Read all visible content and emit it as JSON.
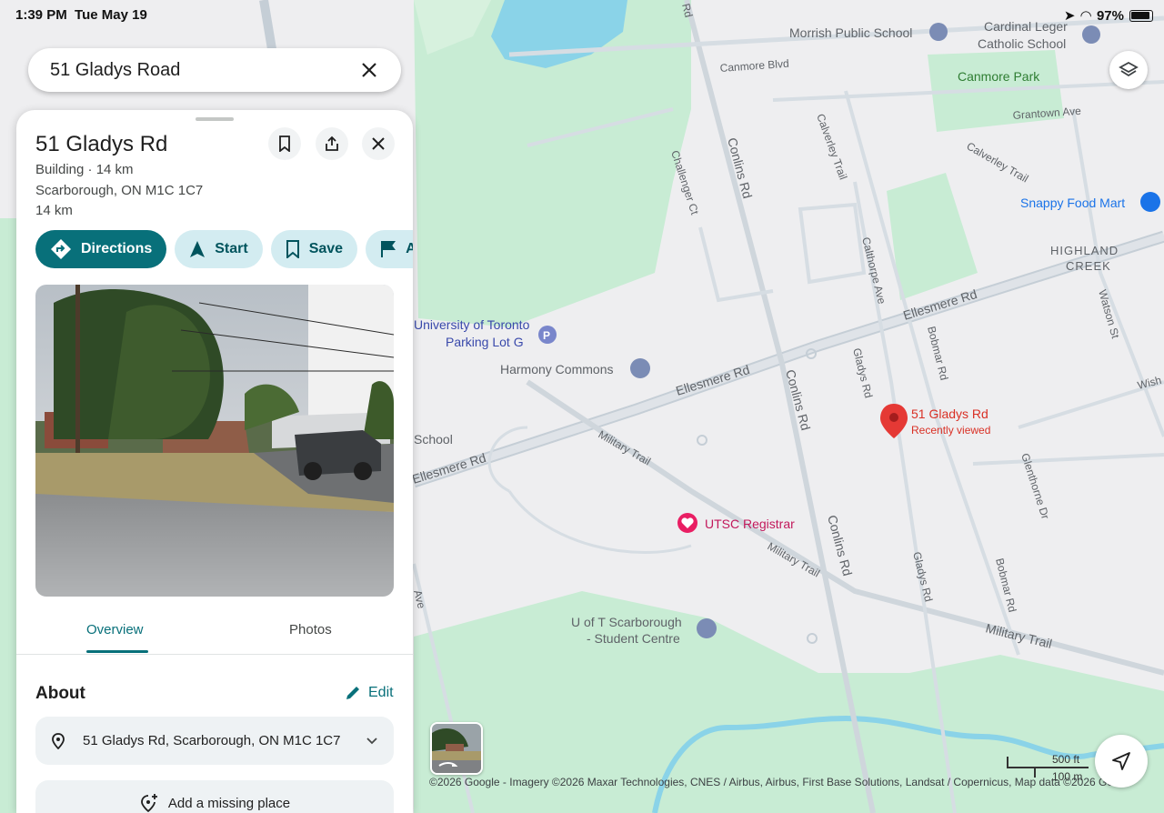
{
  "status_bar": {
    "time": "1:39 PM",
    "date": "Tue May 19",
    "battery": "97%"
  },
  "search": {
    "query": "51 Gladys Road"
  },
  "place": {
    "name": "51 Gladys Rd",
    "category_line": "Building · 14 km",
    "locality": "Scarborough, ON M1C 1C7",
    "distance": "14 km",
    "actions": [
      {
        "label": "Directions",
        "icon": "directions-icon"
      },
      {
        "label": "Start",
        "icon": "navigation-arrow-icon"
      },
      {
        "label": "Save",
        "icon": "bookmark-icon"
      },
      {
        "label": "A",
        "icon": "flag-icon"
      }
    ]
  },
  "tabs": {
    "overview": "Overview",
    "photos": "Photos"
  },
  "about": {
    "heading": "About",
    "edit_label": "Edit",
    "full_address": "51 Gladys Rd, Scarborough, ON M1C 1C7",
    "add_missing": "Add a missing place"
  },
  "map": {
    "pin_label": "51 Gladys Rd",
    "pin_sublabel": "Recently viewed",
    "labels": {
      "morrish": "Morrish Public School",
      "cardinal1": "Cardinal Leger",
      "cardinal2": "Catholic School",
      "canmore_blvd": "Canmore Blvd",
      "canmore_park": "Canmore Park",
      "grantown": "Grantown Ave",
      "calverley1": "Calverley Trail",
      "calverley2": "Calverley Trail",
      "conlins1": "Conlins Rd",
      "conlins2": "Conlins Rd",
      "conlins3": "Conlins Rd",
      "challenger": "Challenger Ct",
      "snappy": "Snappy Food Mart",
      "highland1": "HIGHLAND",
      "highland2": "CREEK",
      "calthorpe": "Calthorpe Ave",
      "watson": "Watson St",
      "ellesmere1": "Ellesmere Rd",
      "ellesmere2": "Ellesmere Rd",
      "ellesmere3": "Ellesmere Rd",
      "uoft1": "University of Toronto",
      "uoft2": "Parking Lot G",
      "harmony": "Harmony Commons",
      "bobmar1": "Bobmar Rd",
      "bobmar2": "Bobmar Rd",
      "gladys1": "Gladys Rd",
      "gladys2": "Gladys Rd",
      "school": "School",
      "military1": "Military Trail",
      "military2": "Military Trail",
      "military3": "Military Trail",
      "wish": "Wish",
      "glenthorne": "Glenthorne Dr",
      "utsc": "UTSC Registrar",
      "student1": "U of T Scarborough",
      "student2": "- Student Centre",
      "ave": "Ave",
      "rd_top": "Rd"
    },
    "scale_ft": "500 ft",
    "scale_m": "100 m",
    "attribution": "©2026 Google - Imagery ©2026 Maxar Technologies, CNES / Airbus, Airbus, First Base Solutions, Landsat / Copernicus, Map data ©2026 Go",
    "colors": {
      "park": "#c8ecd4",
      "road": "#c5ced6",
      "water": "#8ad3e8",
      "accent": "#08707a",
      "pin": "#e53935"
    }
  }
}
